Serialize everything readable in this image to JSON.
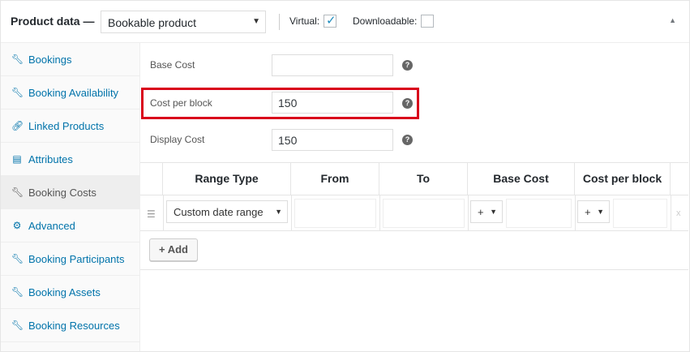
{
  "header": {
    "title": "Product data —",
    "product_type": "Bookable product",
    "virtual_label": "Virtual:",
    "virtual_checked": true,
    "downloadable_label": "Downloadable:",
    "downloadable_checked": false
  },
  "sidebar": {
    "items": [
      {
        "label": "Bookings",
        "icon": "wrench-icon"
      },
      {
        "label": "Booking Availability",
        "icon": "wrench-icon"
      },
      {
        "label": "Linked Products",
        "icon": "link-icon"
      },
      {
        "label": "Attributes",
        "icon": "list-icon"
      },
      {
        "label": "Booking Costs",
        "icon": "wrench-icon",
        "active": true
      },
      {
        "label": "Advanced",
        "icon": "gear-icon"
      },
      {
        "label": "Booking Participants",
        "icon": "wrench-icon"
      },
      {
        "label": "Booking Assets",
        "icon": "wrench-icon"
      },
      {
        "label": "Booking Resources",
        "icon": "wrench-icon"
      }
    ]
  },
  "fields": {
    "base_cost": {
      "label": "Base Cost",
      "value": ""
    },
    "cost_per_block": {
      "label": "Cost per block",
      "value": "150"
    },
    "display_cost": {
      "label": "Display Cost",
      "value": "150"
    }
  },
  "table": {
    "headers": [
      "Range Type",
      "From",
      "To",
      "Base Cost",
      "Cost per block"
    ],
    "row": {
      "range_type": "Custom date range",
      "base_cost_modifier": "+",
      "block_cost_modifier": "+",
      "remove": "x"
    },
    "add_label": "+ Add"
  },
  "colors": {
    "link": "#0073aa",
    "highlight": "#d9001b",
    "check": "#1e8cbe"
  }
}
